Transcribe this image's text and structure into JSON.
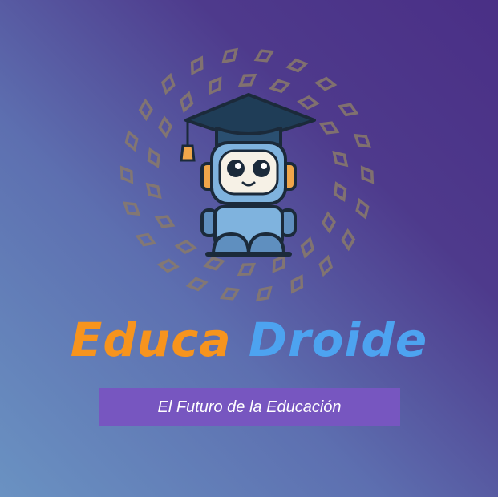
{
  "logo": {
    "name_part1": "Educa",
    "name_part2": "Droide",
    "tagline": "El Futuro de la Educación",
    "icon": "robot-graduate-icon",
    "colors": {
      "name_part1": "#f7941d",
      "name_part2": "#4da3f0",
      "tagline_bg": "#7756c0",
      "diamonds": "#8a7a6a"
    }
  }
}
